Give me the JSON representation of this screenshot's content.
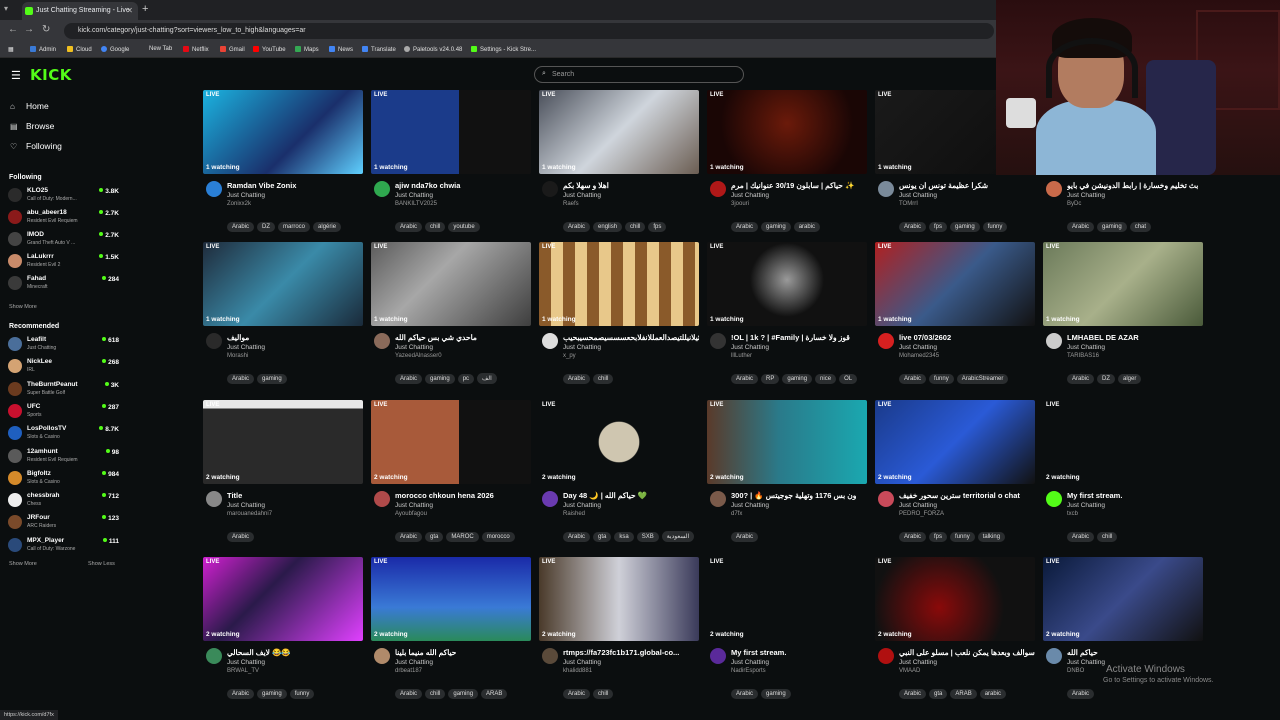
{
  "browser": {
    "tab_title": "Just Chatting Streaming - Live",
    "url": "kick.com/category/just-chatting?sort=viewers_low_to_high&languages=ar",
    "bookmarks": [
      "Admin",
      "Cloud",
      "Google",
      "New Tab",
      "Netflix",
      "Gmail",
      "YouTube",
      "Maps",
      "News",
      "Translate",
      "Paletools v24.0.48",
      "Settings - Kick Stre..."
    ],
    "status_url": "https://kick.com/d7fx"
  },
  "header": {
    "logo": "KICK",
    "search_placeholder": "Search"
  },
  "sidebar": {
    "nav": [
      {
        "label": "Home",
        "icon": "home-icon"
      },
      {
        "label": "Browse",
        "icon": "browse-icon"
      },
      {
        "label": "Following",
        "icon": "heart-icon"
      }
    ],
    "following_title": "Following",
    "following": [
      {
        "name": "KLO25",
        "game": "Call of Duty: Modern...",
        "viewers": "3.8K",
        "color": "#2b2b2b"
      },
      {
        "name": "abu_abeer18",
        "game": "Resident Evil Requiem",
        "viewers": "2.7K",
        "color": "#8b1a1a"
      },
      {
        "name": "IMOD",
        "game": "Grand Theft Auto V ...",
        "viewers": "2.7K",
        "color": "#444"
      },
      {
        "name": "LaLukrrr",
        "game": "Resident Evil 2",
        "viewers": "1.5K",
        "color": "#c98b6a"
      },
      {
        "name": "Fahad",
        "game": "Minecraft",
        "viewers": "284",
        "color": "#3a3a3a"
      }
    ],
    "show_more": "Show More",
    "recommended_title": "Recommended",
    "recommended": [
      {
        "name": "Leafilt",
        "game": "Just Chatting",
        "viewers": "618",
        "color": "#4a6e9a"
      },
      {
        "name": "NickLee",
        "game": "IRL",
        "viewers": "268",
        "color": "#d4a373"
      },
      {
        "name": "TheBurntPeanut",
        "game": "Super Battle Golf",
        "viewers": "3K",
        "color": "#6b3b1f"
      },
      {
        "name": "UFC",
        "game": "Sports",
        "viewers": "287",
        "color": "#c8102e"
      },
      {
        "name": "LosPollosTV",
        "game": "Slots & Casino",
        "viewers": "8.7K",
        "color": "#1f5fbf"
      },
      {
        "name": "12amhunt",
        "game": "Resident Evil Requiem",
        "viewers": "98",
        "color": "#5a5a5a"
      },
      {
        "name": "Bigfoltz",
        "game": "Slots & Casino",
        "viewers": "984",
        "color": "#d58a2a"
      },
      {
        "name": "chessbrah",
        "game": "Chess",
        "viewers": "712",
        "color": "#eeeeee"
      },
      {
        "name": "JRFour",
        "game": "ARC Raiders",
        "viewers": "123",
        "color": "#7a4a2a"
      },
      {
        "name": "MPX_Player",
        "game": "Call of Duty: Warzone",
        "viewers": "111",
        "color": "#2a4a7a"
      }
    ],
    "show_more_2": "Show More",
    "show_less": "Show Less"
  },
  "streams": [
    {
      "title": "Ramdan Vibe Zonix",
      "category": "Just Chatting",
      "channel": "Zonixx2k",
      "viewers": "1 watching",
      "tags": [
        "Arabic",
        "DZ",
        "marroco",
        "algérie"
      ],
      "thumb": "linear-gradient(135deg,#1bb3e0,#1a2f6b 60%,#5fd0ff)",
      "avatar": "#2a7fd6"
    },
    {
      "title": "ajiw nda7ko chwia",
      "category": "Just Chatting",
      "channel": "BANKILTV2025",
      "viewers": "1 watching",
      "tags": [
        "Arabic",
        "chill",
        "youtube"
      ],
      "thumb": "linear-gradient(90deg,#1b3b8a 0%,#1b3b8a 55%,#111 55%)",
      "avatar": "#2fa84f"
    },
    {
      "title": "اهلا و سهلا بكم",
      "category": "Just Chatting",
      "channel": "Raefs",
      "viewers": "1 watching",
      "tags": [
        "Arabic",
        "english",
        "chill",
        "fps"
      ],
      "thumb": "linear-gradient(135deg,#4a4f5a,#cfd5dc 50%,#6b5d52)",
      "avatar": "#1a1a1a"
    },
    {
      "title": "حياكم | سابلون 30/19 عنوانيك | مرم ✨",
      "category": "Just Chatting",
      "channel": "3joouri",
      "viewers": "1 watching",
      "tags": [
        "Arabic",
        "gaming",
        "arabic"
      ],
      "thumb": "radial-gradient(circle at 50% 40%,#6b1a0a,#1a0605 70%)",
      "avatar": "#b01818"
    },
    {
      "title": "شكرا عظيمة تونس ان يونس",
      "category": "Just Chatting",
      "channel": "TOMrrI",
      "viewers": "1 watching",
      "tags": [
        "Arabic",
        "fps",
        "gaming",
        "funny"
      ],
      "thumb": "linear-gradient(135deg,#1a1a1a,#0d0d0d)",
      "avatar": "#7a8a9a"
    },
    {
      "title": "بث تخليم وخسارة | رابط الدونيشن في بايو",
      "category": "Just Chatting",
      "channel": "ByDc",
      "viewers": "1 watching",
      "tags": [
        "Arabic",
        "gaming",
        "chat"
      ],
      "thumb": "linear-gradient(135deg,#1c0f10,#3a1a1a)",
      "avatar": "#c96a4a"
    },
    {
      "title": "مواليف",
      "category": "Just Chatting",
      "channel": "Morashi",
      "viewers": "1 watching",
      "tags": [
        "Arabic",
        "gaming"
      ],
      "thumb": "linear-gradient(135deg,#1f2b3b,#3a8aa8 50%,#1a2a3a)",
      "avatar": "#2a2a2a"
    },
    {
      "title": "ماحدي شي بس حياكم الله",
      "category": "Just Chatting",
      "channel": "YazeedAlnasser0",
      "viewers": "1 watching",
      "tags": [
        "Arabic",
        "gaming",
        "pc",
        "الف"
      ],
      "thumb": "linear-gradient(135deg,#5b5b5b,#a7a7a7 40%,#3e3e3e)",
      "avatar": "#8a6a5a"
    },
    {
      "title": "لا بثيلانيللتيصدالعمللانفلابحعسسسيصمحسيبحيب",
      "category": "Just Chatting",
      "channel": "x_py",
      "viewers": "1 watching",
      "tags": [
        "Arabic",
        "chill"
      ],
      "thumb": "repeating-linear-gradient(90deg,#8a5a2a 0 12px,#e8c88a 12px 24px)",
      "avatar": "#ddd"
    },
    {
      "title": "!OL | 1k ? | #Family | قوز ولا خسارة",
      "category": "Just Chatting",
      "channel": "lllLuther",
      "viewers": "1 watching",
      "tags": [
        "Arabic",
        "RP",
        "gaming",
        "nice",
        "OL"
      ],
      "thumb": "radial-gradient(circle at 50% 45%,#9a9a9a,#111 40%)",
      "avatar": "#333"
    },
    {
      "title": "live 07/03/2602",
      "category": "Just Chatting",
      "channel": "Mohamed2345",
      "viewers": "1 watching",
      "tags": [
        "Arabic",
        "funny",
        "ArabicStreamer"
      ],
      "thumb": "linear-gradient(135deg,#b02020,#3a5a8a 50%,#111)",
      "avatar": "#d62020"
    },
    {
      "title": "LMHABEL DE AZAR",
      "category": "Just Chatting",
      "channel": "TARIBAS16",
      "viewers": "1 watching",
      "tags": [
        "Arabic",
        "DZ",
        "alger"
      ],
      "thumb": "linear-gradient(135deg,#6b7a5a,#a8b08a 50%,#4a5a3a)",
      "avatar": "#ccc"
    },
    {
      "title": "Title",
      "category": "Just Chatting",
      "channel": "marouanedahni7",
      "viewers": "2 watching",
      "tags": [
        "Arabic"
      ],
      "thumb": "linear-gradient(180deg,#e8e8e8 0 10%,#2a2a2a 10% 100%)",
      "avatar": "#888"
    },
    {
      "title": "morocco chkoun hena 2026",
      "category": "Just Chatting",
      "channel": "Ayoubfagou",
      "viewers": "2 watching",
      "tags": [
        "Arabic",
        "gta",
        "MAROC",
        "morocco"
      ],
      "thumb": "linear-gradient(90deg,#a85a3a 0%,#a85a3a 55%,#111 55%)",
      "avatar": "#b04a4a"
    },
    {
      "title": "Day 48 🌙 | حياكم الله 💚",
      "category": "Just Chatting",
      "channel": "Raished",
      "viewers": "2 watching",
      "tags": [
        "Arabic",
        "gta",
        "ksa",
        "SXB",
        "السعودية"
      ],
      "thumb": "radial-gradient(circle at 50% 50%,#cfc6b0 0 22%,#0b0e0f 23%)",
      "avatar": "#6a3ab0"
    },
    {
      "title": "300? | 🔥 ون بس 1176 وتهلية جوجيتس",
      "category": "Just Chatting",
      "channel": "d7fx",
      "viewers": "2 watching",
      "tags": [
        "Arabic"
      ],
      "thumb": "linear-gradient(90deg,#5a3a2a 0%,#2a7a8a 45%,#1aa8b0)",
      "avatar": "#7a5a4a"
    },
    {
      "title": "سترين سحور خفيف territorial o chat",
      "category": "Just Chatting",
      "channel": "PEDRO_FORZA",
      "viewers": "2 watching",
      "tags": [
        "Arabic",
        "fps",
        "funny",
        "talking"
      ],
      "thumb": "linear-gradient(135deg,#1a3a8a,#2a5ad6 50%,#111)",
      "avatar": "#c94a5a"
    },
    {
      "title": "My first stream.",
      "category": "Just Chatting",
      "channel": "txcb",
      "viewers": "2 watching",
      "tags": [
        "Arabic",
        "chill"
      ],
      "thumb": "linear-gradient(135deg,#0b0e0f,#0b0e0f)",
      "avatar": "#53fc18"
    },
    {
      "title": "لايف السحالي 😂😂",
      "category": "Just Chatting",
      "channel": "BRWAL_TV",
      "viewers": "2 watching",
      "tags": [
        "Arabic",
        "gaming",
        "funny"
      ],
      "thumb": "linear-gradient(135deg,#d020d0,#2a1a4a 40%,#e040ff)",
      "avatar": "#3a8a5a"
    },
    {
      "title": "حياكم الله منيما بلينا",
      "category": "Just Chatting",
      "channel": "drbeat187",
      "viewers": "2 watching",
      "tags": [
        "Arabic",
        "chill",
        "gaming",
        "ARAB"
      ],
      "thumb": "linear-gradient(180deg,#1a2aa8,#3a7ad6 60%,#2a8a5a)",
      "avatar": "#b08a6a"
    },
    {
      "title": "rtmps://fa723fc1b171.global-co...",
      "category": "Just Chatting",
      "channel": "khalidd881",
      "viewers": "2 watching",
      "tags": [
        "Arabic",
        "chill"
      ],
      "thumb": "linear-gradient(90deg,#4a3a2a,#cfd0d8 50%,#3a3a5a)",
      "avatar": "#5a4a3a"
    },
    {
      "title": "My first stream.",
      "category": "Just Chatting",
      "channel": "NadirEsports",
      "viewers": "2 watching",
      "tags": [
        "Arabic",
        "gaming"
      ],
      "thumb": "linear-gradient(135deg,#0b0e0f,#0b0e0f)",
      "avatar": "#5a2a9a"
    },
    {
      "title": "سوالف وبعدها يمكن نلعب | مسلو على النبي",
      "category": "Just Chatting",
      "channel": "VMAAD",
      "viewers": "2 watching",
      "tags": [
        "Arabic",
        "gta",
        "ARAB",
        "arabic"
      ],
      "thumb": "radial-gradient(circle at 40% 60%,#8a0a0a,#111 60%)",
      "avatar": "#b01010"
    },
    {
      "title": "حياكم الله",
      "category": "Just Chatting",
      "channel": "DNBO",
      "viewers": "2 watching",
      "tags": [
        "Arabic"
      ],
      "thumb": "linear-gradient(135deg,#0a1a3a,#3a4a8a 50%,#111)",
      "avatar": "#6a8aaa"
    }
  ],
  "overlay": {
    "activate_title": "Activate Windows",
    "activate_sub": "Go to Settings to activate Windows."
  },
  "colors": {
    "brand": "#53fc18",
    "background": "#0b0e0f"
  }
}
